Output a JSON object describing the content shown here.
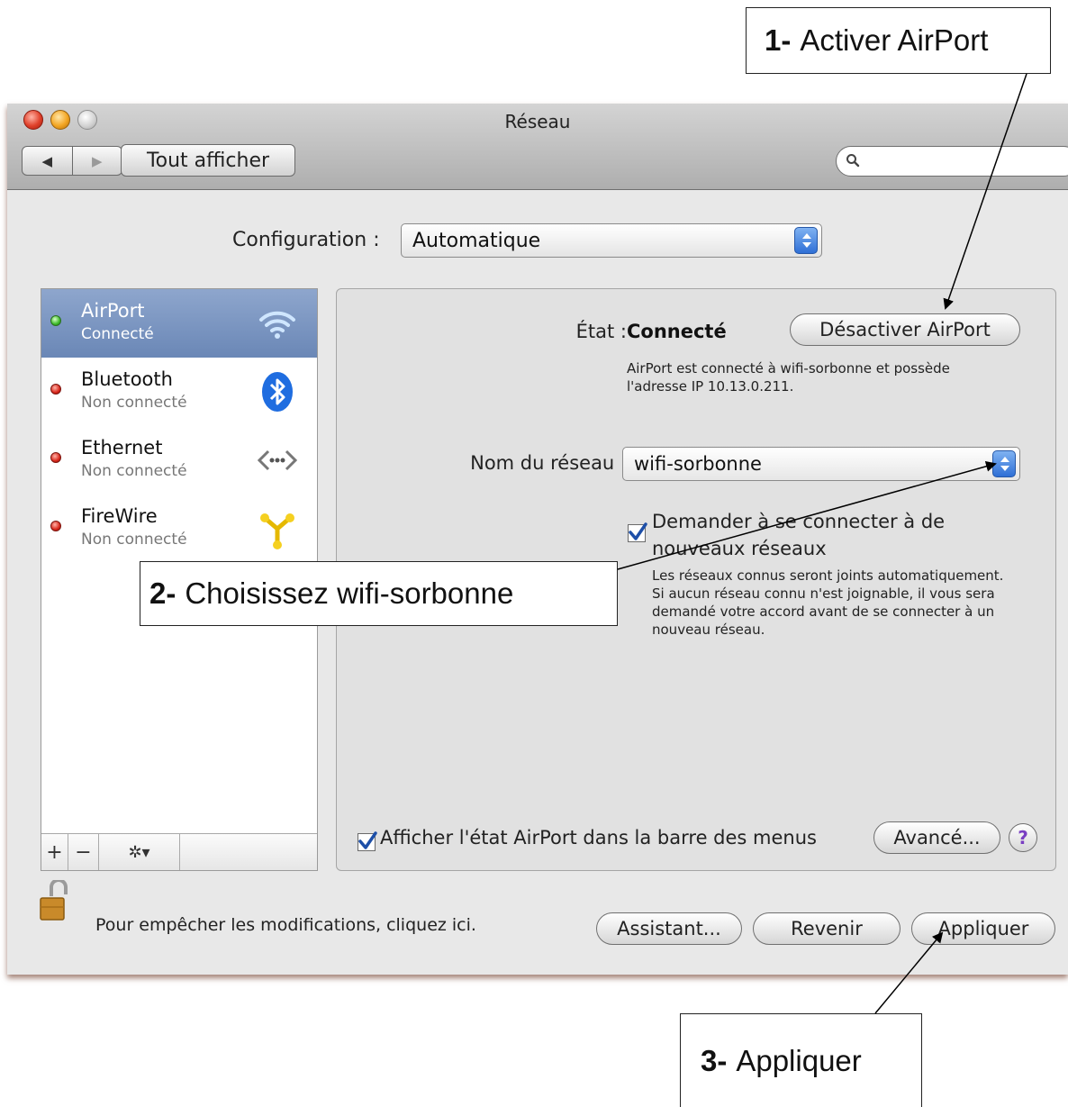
{
  "window": {
    "title": "Réseau"
  },
  "toolbar": {
    "back_icon": "back-arrow-icon",
    "forward_icon": "forward-arrow-icon",
    "show_all_label": "Tout afficher",
    "search_placeholder": ""
  },
  "config": {
    "label": "Configuration :",
    "value": "Automatique"
  },
  "services": [
    {
      "name": "AirPort",
      "status": "Connecté",
      "indicator": "green",
      "icon": "wifi-icon",
      "selected": true
    },
    {
      "name": "Bluetooth",
      "status": "Non connecté",
      "indicator": "red",
      "icon": "bluetooth-icon"
    },
    {
      "name": "Ethernet",
      "status": "Non connecté",
      "indicator": "red",
      "icon": "ethernet-icon"
    },
    {
      "name": "FireWire",
      "status": "Non connecté",
      "indicator": "red",
      "icon": "firewire-icon"
    }
  ],
  "sidebar_toolbar": {
    "add": "+",
    "remove": "−",
    "gear": "✲▾"
  },
  "detail": {
    "state_label": "État :",
    "state_value": "Connecté",
    "disable_button": "Désactiver AirPort",
    "state_desc": "AirPort est connecté à wifi-sorbonne et possède l'adresse IP 10.13.0.211.",
    "network_label": "Nom du réseau :",
    "network_value": "wifi-sorbonne",
    "ask_checkbox_label": "Demander à se connecter à de nouveaux réseaux",
    "ask_checked": true,
    "ask_desc": "Les réseaux connus seront joints automatiquement. Si aucun réseau connu n'est joignable, il vous sera demandé votre accord avant de se connecter à un nouveau réseau.",
    "show_menu_label": "Afficher l'état AirPort dans la barre des menus",
    "show_menu_checked": true,
    "advanced_button": "Avancé...",
    "help_button": "?"
  },
  "bottom": {
    "lock_text": "Pour empêcher les modifications, cliquez ici.",
    "assistant_button": "Assistant...",
    "revert_button": "Revenir",
    "apply_button": "Appliquer"
  },
  "callouts": [
    {
      "number": "1-",
      "text": "Activer AirPort"
    },
    {
      "number": "2-",
      "text": "Choisissez wifi-sorbonne"
    },
    {
      "number": "3-",
      "text": "Appliquer"
    }
  ],
  "colors": {
    "selection": "#7894c2",
    "status_ok": "#3dbb2a",
    "status_off": "#d8261a",
    "accent_blue": "#2f6fd6"
  }
}
